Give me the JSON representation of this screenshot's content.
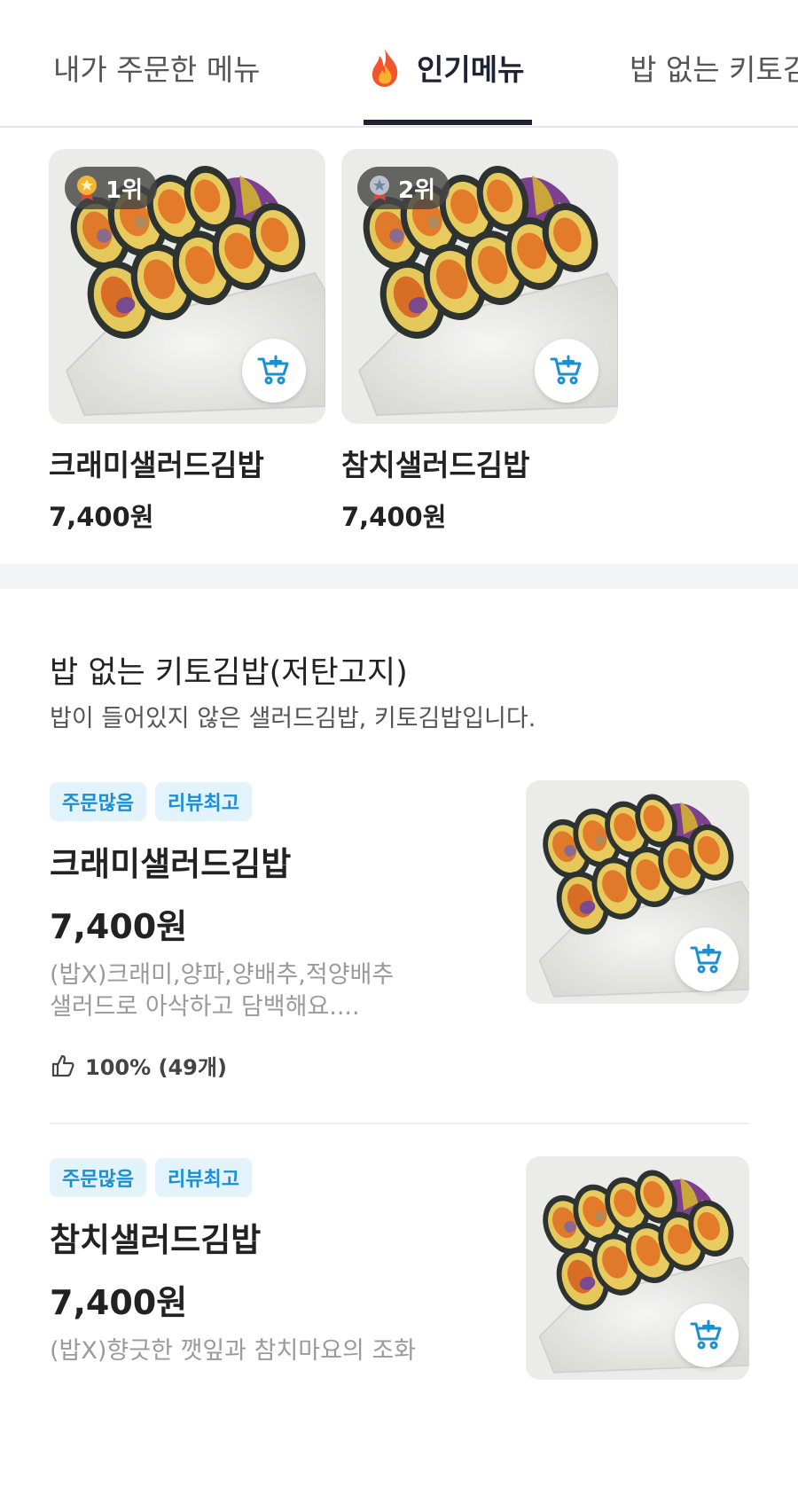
{
  "tabs": [
    {
      "label": "내가 주문한 메뉴",
      "active": false
    },
    {
      "label": "인기메뉴",
      "active": true,
      "icon": "fire-icon"
    },
    {
      "label": "밥 없는 키토김밥",
      "active": false
    }
  ],
  "popular": [
    {
      "rank": "1위",
      "medal": "gold-medal-icon",
      "name": "크래미샐러드김밥",
      "price": "7,400원"
    },
    {
      "rank": "2위",
      "medal": "silver-medal-icon",
      "name": "참치샐러드김밥",
      "price": "7,400원"
    }
  ],
  "category": {
    "title": "밥 없는 키토김밥(저탄고지)",
    "description": "밥이 들어있지 않은 샐러드김밥, 키토김밥입니다."
  },
  "items": [
    {
      "badges": [
        "주문많음",
        "리뷰최고"
      ],
      "name": "크래미샐러드김밥",
      "price": "7,400원",
      "desc_line1": "(밥X)크래미,양파,양배추,적양배추",
      "desc_line2": "샐러드로 아삭하고 담백해요....",
      "rating": "100% (49개)"
    },
    {
      "badges": [
        "주문많음",
        "리뷰최고"
      ],
      "name": "참치샐러드김밥",
      "price": "7,400원",
      "desc_line1": "(밥X)향긋한 깻잎과 참치마요의 조화"
    }
  ],
  "colors": {
    "accent": "#1a8fd1",
    "active_tab": "#1f2233",
    "badge_bg": "#e3f3fc"
  }
}
